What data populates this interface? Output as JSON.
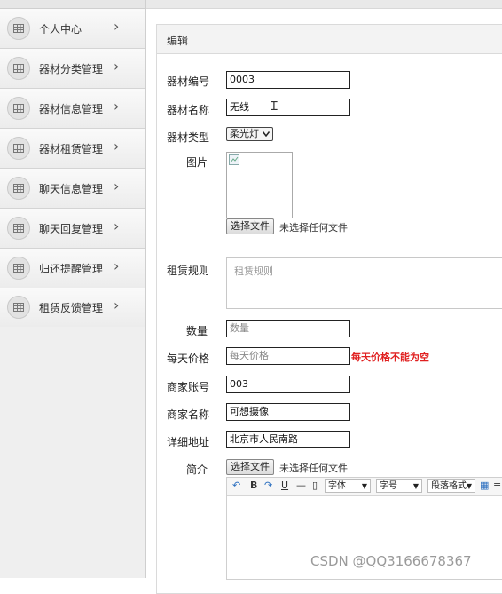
{
  "sidebar": {
    "items": [
      {
        "label": "个人中心"
      },
      {
        "label": "器材分类管理"
      },
      {
        "label": "器材信息管理"
      },
      {
        "label": "器材租赁管理"
      },
      {
        "label": "聊天信息管理"
      },
      {
        "label": "聊天回复管理"
      },
      {
        "label": "归还提醒管理"
      },
      {
        "label": "租赁反馈管理"
      }
    ],
    "chevron": "›"
  },
  "panel": {
    "title": "编辑"
  },
  "form": {
    "equip_no": {
      "label": "器材编号",
      "value": "0003"
    },
    "equip_name": {
      "label": "器材名称",
      "value": "无线"
    },
    "equip_type": {
      "label": "器材类型",
      "selected": "柔光灯"
    },
    "image": {
      "label": "图片",
      "button": "选择文件",
      "status": "未选择任何文件"
    },
    "rental_rules": {
      "label": "租赁规则",
      "placeholder": "租赁规则"
    },
    "quantity": {
      "label": "数量",
      "placeholder": "数量"
    },
    "daily_price": {
      "label": "每天价格",
      "placeholder": "每天价格",
      "error": "每天价格不能为空"
    },
    "merchant_account": {
      "label": "商家账号",
      "value": "003"
    },
    "merchant_name": {
      "label": "商家名称",
      "value": "可想摄像"
    },
    "address": {
      "label": "详细地址",
      "value": "北京市人民南路"
    },
    "intro": {
      "label": "简介",
      "button": "选择文件",
      "status": "未选择任何文件"
    }
  },
  "editor": {
    "bold": "B",
    "underline": "U",
    "font_family": "字体",
    "font_size": "字号",
    "paragraph": "段落格式"
  },
  "watermark": "CSDN @QQ3166678367",
  "colors": {
    "error": "#e02020",
    "sidebar_bg": "#f1f1f1",
    "panel_head": "#f3f3f3"
  }
}
